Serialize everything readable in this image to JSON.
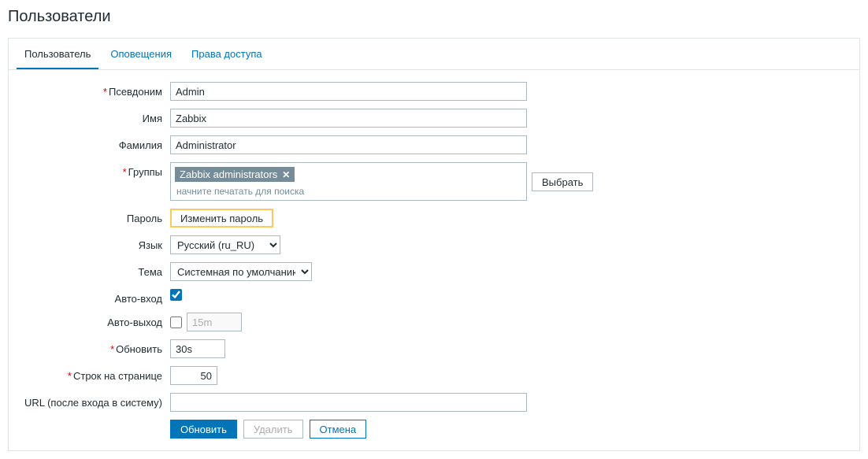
{
  "page_title": "Пользователи",
  "tabs": [
    {
      "label": "Пользователь",
      "active": true
    },
    {
      "label": "Оповещения",
      "active": false
    },
    {
      "label": "Права доступа",
      "active": false
    }
  ],
  "labels": {
    "alias": "Псевдоним",
    "name": "Имя",
    "surname": "Фамилия",
    "groups": "Группы",
    "password": "Пароль",
    "language": "Язык",
    "theme": "Тема",
    "autologin": "Авто-вход",
    "autologout": "Авто-выход",
    "refresh": "Обновить",
    "rows": "Строк на странице",
    "url": "URL (после входа в систему)"
  },
  "values": {
    "alias": "Admin",
    "name": "Zabbix",
    "surname": "Administrator",
    "group_tag": "Zabbix administrators",
    "group_placeholder": "начните печатать для поиска",
    "language": "Русский (ru_RU)",
    "theme": "Системная по умолчанию",
    "autologin": true,
    "autologout_checked": false,
    "autologout_value": "15m",
    "refresh": "30s",
    "rows": "50",
    "url": ""
  },
  "buttons": {
    "select": "Выбрать",
    "change_password": "Изменить пароль",
    "update": "Обновить",
    "delete": "Удалить",
    "cancel": "Отмена"
  }
}
